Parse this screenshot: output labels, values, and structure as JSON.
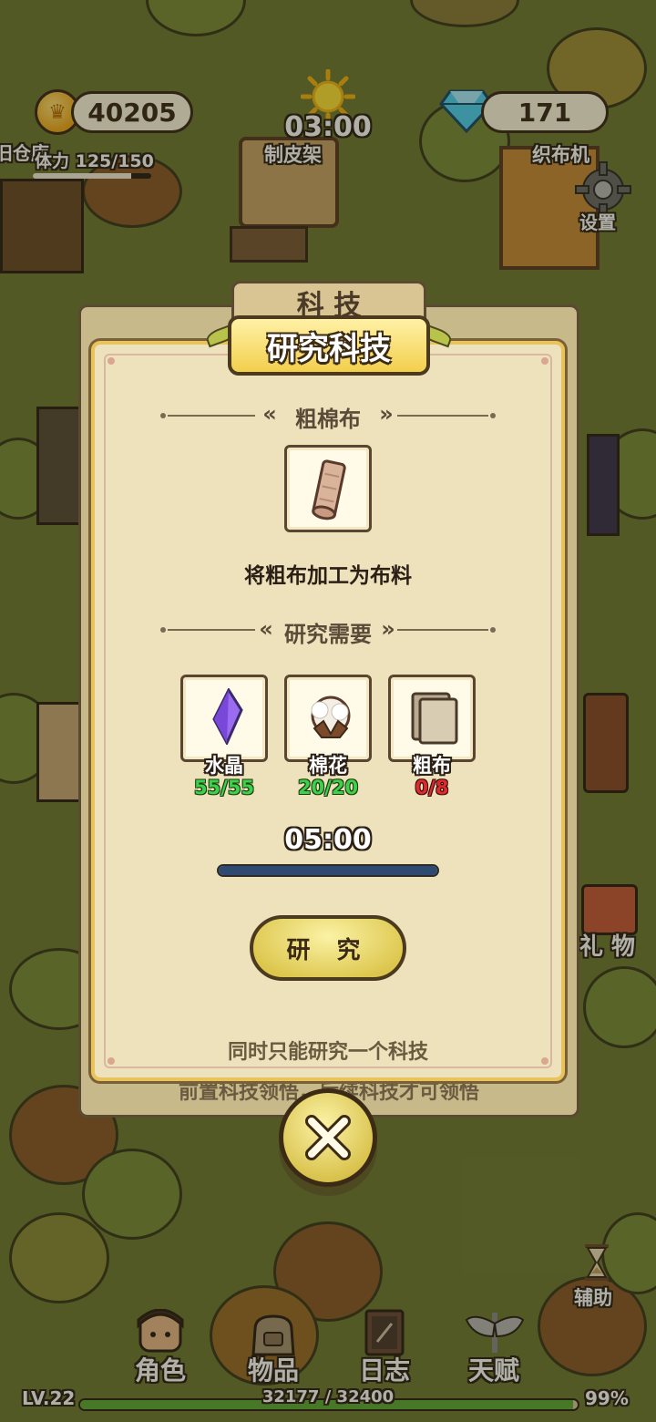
{
  "hud": {
    "coins": "40205",
    "gems": "171",
    "time": "03:00",
    "stamina_label": "体力 125/150",
    "stamina": {
      "current": 125,
      "max": 150
    },
    "warehouse_label": "旧仓库",
    "settings_label": "设置"
  },
  "map_labels": {
    "tanning_rack": "制皮架",
    "loom": "织布机",
    "gift": "礼 物",
    "assist": "辅助"
  },
  "back_panel": {
    "tab_title": "科 技",
    "footer": "前置科技领悟，后续科技才可领悟"
  },
  "dialog": {
    "title": "研究科技",
    "tech_name": "粗棉布",
    "description": "将粗布加工为布料",
    "requirements_title": "研究需要",
    "requirements": [
      {
        "name": "水晶",
        "count": "55/55",
        "met": true
      },
      {
        "name": "棉花",
        "count": "20/20",
        "met": true
      },
      {
        "name": "粗布",
        "count": "0/8",
        "met": false
      }
    ],
    "duration": "05:00",
    "progress": 1.0,
    "research_button": "研 究",
    "note": "同时只能研究一个科技"
  },
  "bottom_nav": [
    {
      "label": "角色",
      "icon": "character-icon"
    },
    {
      "label": "物品",
      "icon": "bag-icon"
    },
    {
      "label": "日志",
      "icon": "journal-icon"
    },
    {
      "label": "天赋",
      "icon": "wings-icon"
    }
  ],
  "level": {
    "label": "LV.22",
    "xp_text": "32177 / 32400",
    "percent_text": "99%",
    "fraction": 0.99
  },
  "colors": {
    "met": "#3bd24a",
    "unmet": "#e02a2a",
    "progress_fill": "#2f4a70"
  }
}
